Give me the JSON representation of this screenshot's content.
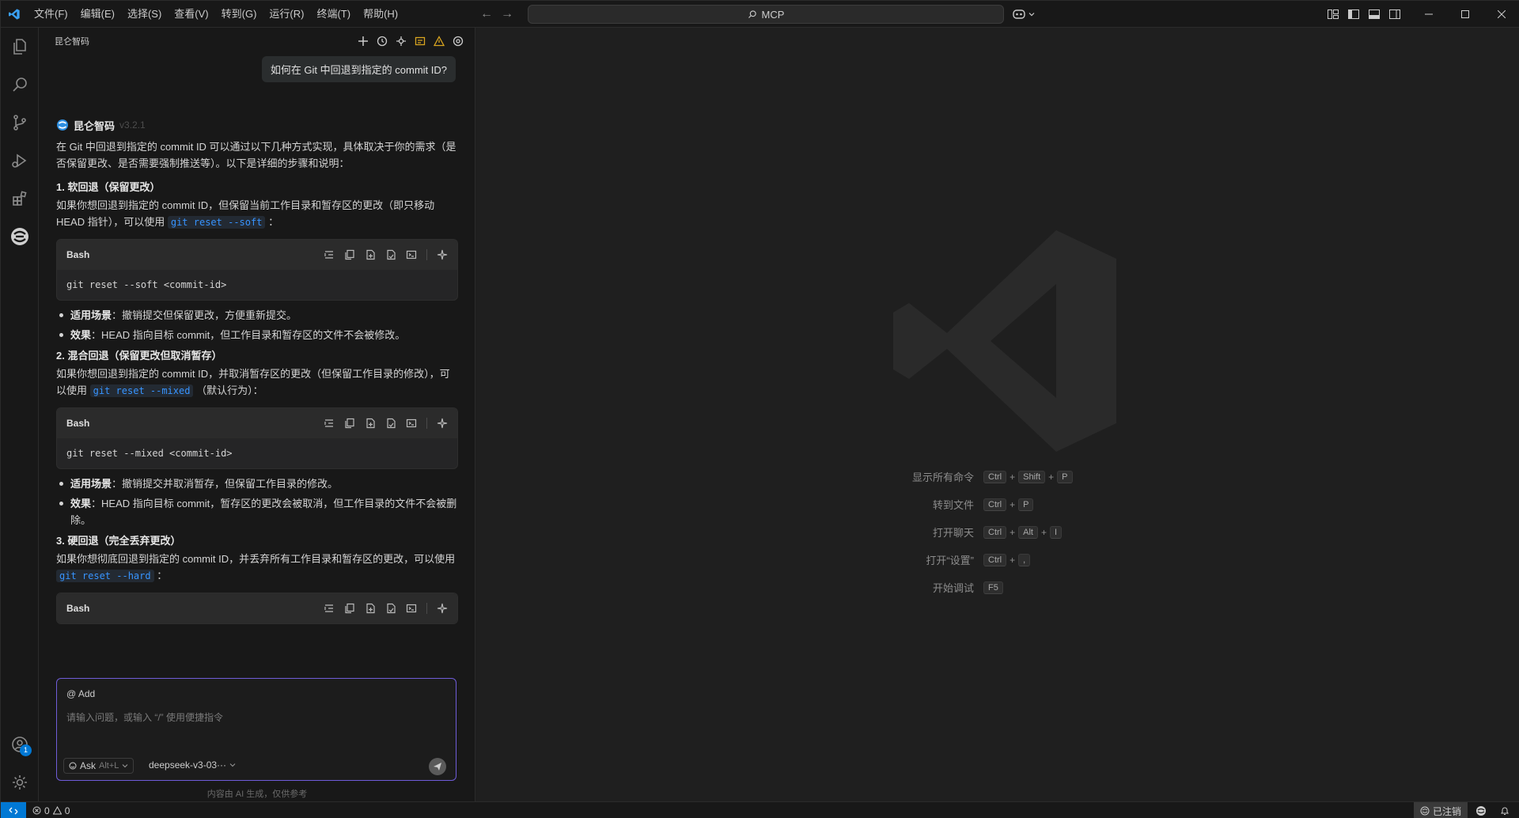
{
  "menu": [
    "文件(F)",
    "编辑(E)",
    "选择(S)",
    "查看(V)",
    "转到(G)",
    "运行(R)",
    "终端(T)",
    "帮助(H)"
  ],
  "command_center": {
    "text": "MCP"
  },
  "panel": {
    "title": "昆仑智码",
    "user_message": "如何在 Git 中回退到指定的 commit ID?",
    "assistant_name": "昆仑智码",
    "assistant_version": "v3.2.1",
    "intro": "在 Git 中回退到指定的 commit ID 可以通过以下几种方式实现，具体取决于你的需求（是否保留更改、是否需要强制推送等）。以下是详细的步骤和说明：",
    "sections": [
      {
        "heading": "1. 软回退（保留更改）",
        "text_before": "如果你想回退到指定的 commit ID，但保留当前工作目录和暂存区的更改（即只移动 HEAD 指针），可以使用",
        "code_inline": "git reset --soft",
        "text_after": "：",
        "code_lang": "Bash",
        "code": "git reset --soft <commit-id>",
        "bullets": [
          {
            "label": "适用场景",
            "text": "：撤销提交但保留更改，方便重新提交。"
          },
          {
            "label": "效果",
            "text": "：HEAD 指向目标 commit，但工作目录和暂存区的文件不会被修改。"
          }
        ]
      },
      {
        "heading": "2. 混合回退（保留更改但取消暂存）",
        "text_before": "如果你想回退到指定的 commit ID，并取消暂存区的更改（但保留工作目录的修改），可以使用",
        "code_inline": "git reset --mixed",
        "text_after": "（默认行为）：",
        "code_lang": "Bash",
        "code": "git reset --mixed <commit-id>",
        "bullets": [
          {
            "label": "适用场景",
            "text": "：撤销提交并取消暂存，但保留工作目录的修改。"
          },
          {
            "label": "效果",
            "text": "：HEAD 指向目标 commit，暂存区的更改会被取消，但工作目录的文件不会被删除。"
          }
        ]
      },
      {
        "heading": "3. 硬回退（完全丢弃更改）",
        "text_before": "如果你想彻底回退到指定的 commit ID，并丢弃所有工作目录和暂存区的更改，可以使用",
        "code_inline": "git reset --hard",
        "text_after": "：",
        "code_lang": "Bash",
        "code": "",
        "bullets": []
      }
    ],
    "input": {
      "add_label": "@ Add",
      "placeholder": "请输入问题，或输入 “/” 使用便捷指令",
      "mode": "Ask",
      "mode_shortcut": "Alt+L",
      "model": "deepseek-v3-03···"
    },
    "disclaimer": "内容由 AI 生成，仅供参考"
  },
  "shortcuts": [
    {
      "label": "显示所有命令",
      "keys": [
        "Ctrl",
        "Shift",
        "P"
      ]
    },
    {
      "label": "转到文件",
      "keys": [
        "Ctrl",
        "P"
      ]
    },
    {
      "label": "打开聊天",
      "keys": [
        "Ctrl",
        "Alt",
        "I"
      ]
    },
    {
      "label": "打开“设置”",
      "keys": [
        "Ctrl",
        ","
      ]
    },
    {
      "label": "开始调试",
      "keys": [
        "F5"
      ]
    }
  ],
  "statusbar": {
    "errors": "0",
    "warnings": "0",
    "login": "已注销"
  },
  "account_badge": "1",
  "colors": {
    "accent": "#0078d4",
    "input_border": "#6f5cd8",
    "inline_code": "#3794ff"
  }
}
